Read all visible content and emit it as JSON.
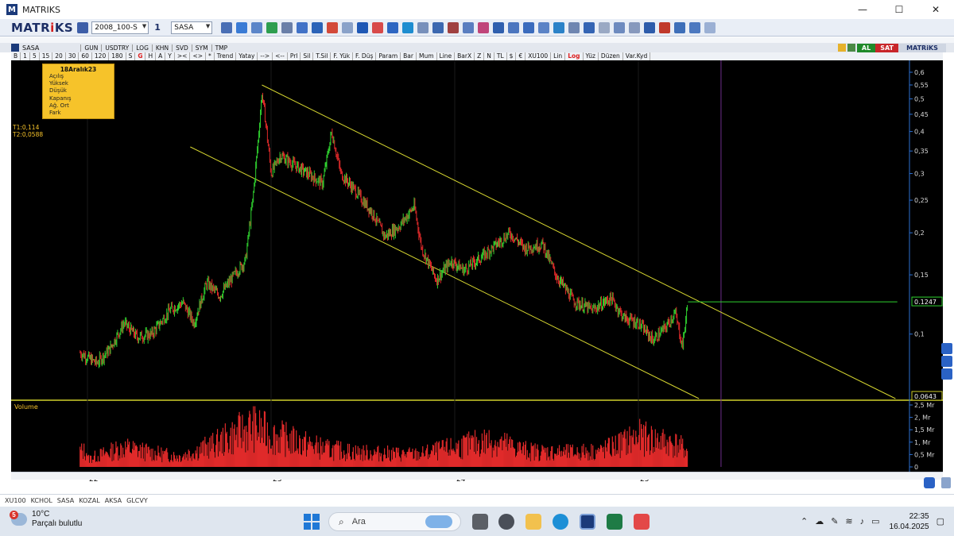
{
  "window": {
    "title": "MATRIKS",
    "min": "—",
    "max": "☐",
    "close": "✕"
  },
  "toolbar": {
    "brand_part1": "MATR",
    "brand_part2": "i",
    "brand_part3": "KS",
    "layout_value": "2008_100-S",
    "count_value": "1",
    "symbol_value": "SASA"
  },
  "toolbar2": {
    "symbol": "SASA",
    "headers": [
      "GUN",
      "USDTRY",
      "LOG",
      "KHN",
      "SVD",
      "SYM",
      "TMP"
    ],
    "buttons": [
      "AL",
      "SAT",
      "MATRiKS"
    ]
  },
  "toolbar3": {
    "items": [
      "B",
      "1",
      "5",
      "15",
      "20",
      "30",
      "60",
      "120",
      "180",
      "S",
      "G",
      "H",
      "A",
      "Y",
      "><",
      "<>",
      "*",
      "Trend",
      "Yatay",
      "-->",
      "<--",
      "Prl",
      "Sil",
      "T.Sil",
      "F. Yük",
      "F. Düş",
      "Param",
      "Bar",
      "Mum",
      "Line",
      "BarX",
      "Z",
      "N",
      "TL",
      "$",
      "€",
      "XU100",
      "Lin",
      "Log",
      "Yüz",
      "Düzen",
      "Var.Kyd"
    ],
    "active": [
      "G",
      "Log"
    ]
  },
  "infobox": {
    "date": "18Aralık23",
    "rows": [
      "Açılış",
      "Yüksek",
      "Düşük",
      "Kapanış",
      "Ağ. Ort",
      "Fark"
    ]
  },
  "tvalues": {
    "t1": "T1:0,114",
    "t2": "T2:0,0588"
  },
  "chart_data": {
    "type": "candlestick",
    "symbol": "SASA",
    "scale": "log",
    "price_axis_ticks": [
      "0,6",
      "0,55",
      "0,5",
      "0,45",
      "0,4",
      "0,35",
      "0,3",
      "0,25",
      "0,2",
      "0,15",
      "0,1"
    ],
    "price_axis_values": [
      0.6,
      0.55,
      0.5,
      0.45,
      0.4,
      0.35,
      0.3,
      0.25,
      0.2,
      0.15,
      0.1
    ],
    "ylim": [
      0.0643,
      0.63
    ],
    "current_price_label": "0.1247",
    "current_price": 0.1247,
    "min_label": "0.0643",
    "x_labels": [
      "22",
      "23",
      "24",
      "25"
    ],
    "x_label_positions_years": [
      2022,
      2023,
      2024,
      2025
    ],
    "price_path": [
      [
        2021.96,
        0.088
      ],
      [
        2022.05,
        0.082
      ],
      [
        2022.12,
        0.09
      ],
      [
        2022.2,
        0.108
      ],
      [
        2022.27,
        0.098
      ],
      [
        2022.35,
        0.1
      ],
      [
        2022.45,
        0.118
      ],
      [
        2022.52,
        0.124
      ],
      [
        2022.58,
        0.108
      ],
      [
        2022.65,
        0.142
      ],
      [
        2022.72,
        0.13
      ],
      [
        2022.8,
        0.15
      ],
      [
        2022.86,
        0.165
      ],
      [
        2022.9,
        0.25
      ],
      [
        2022.93,
        0.38
      ],
      [
        2022.95,
        0.52
      ],
      [
        2022.97,
        0.43
      ],
      [
        2023.0,
        0.3
      ],
      [
        2023.05,
        0.34
      ],
      [
        2023.12,
        0.32
      ],
      [
        2023.2,
        0.3
      ],
      [
        2023.28,
        0.28
      ],
      [
        2023.33,
        0.4
      ],
      [
        2023.38,
        0.3
      ],
      [
        2023.45,
        0.27
      ],
      [
        2023.55,
        0.23
      ],
      [
        2023.62,
        0.195
      ],
      [
        2023.7,
        0.21
      ],
      [
        2023.78,
        0.24
      ],
      [
        2023.82,
        0.18
      ],
      [
        2023.9,
        0.145
      ],
      [
        2023.98,
        0.165
      ],
      [
        2024.05,
        0.155
      ],
      [
        2024.15,
        0.17
      ],
      [
        2024.3,
        0.2
      ],
      [
        2024.38,
        0.18
      ],
      [
        2024.48,
        0.185
      ],
      [
        2024.55,
        0.15
      ],
      [
        2024.65,
        0.125
      ],
      [
        2024.75,
        0.118
      ],
      [
        2024.85,
        0.128
      ],
      [
        2024.92,
        0.112
      ],
      [
        2025.0,
        0.108
      ],
      [
        2025.08,
        0.096
      ],
      [
        2025.15,
        0.105
      ],
      [
        2025.2,
        0.116
      ],
      [
        2025.24,
        0.092
      ],
      [
        2025.27,
        0.1247
      ]
    ],
    "channel_upper": {
      "start": [
        2022.95,
        0.55
      ],
      "end": [
        2026.4,
        0.0643
      ]
    },
    "channel_lower": {
      "start": [
        2022.56,
        0.36
      ],
      "end": [
        2025.33,
        0.0643
      ]
    },
    "horizontal_line": {
      "price": 0.1247,
      "from": 2025.27,
      "to": 2026.41
    },
    "vertical_marker": 2025.45,
    "volume": {
      "label": "Volume",
      "axis_ticks": [
        "2,5 Mr",
        "2, Mr",
        "1,5 Mr",
        "1, Mr",
        "0,5 Mr",
        "0"
      ],
      "axis_values": [
        2.5,
        2.0,
        1.5,
        1.0,
        0.5,
        0
      ],
      "units": "Mr",
      "profile": [
        [
          2022.0,
          0.45
        ],
        [
          2022.2,
          1.1
        ],
        [
          2022.35,
          0.8
        ],
        [
          2022.5,
          0.6
        ],
        [
          2022.7,
          1.3
        ],
        [
          2022.9,
          2.3
        ],
        [
          2023.0,
          1.8
        ],
        [
          2023.3,
          1.0
        ],
        [
          2023.5,
          0.8
        ],
        [
          2023.8,
          0.7
        ],
        [
          2024.0,
          1.1
        ],
        [
          2024.2,
          1.5
        ],
        [
          2024.4,
          0.9
        ],
        [
          2024.6,
          0.8
        ],
        [
          2024.8,
          0.9
        ],
        [
          2025.0,
          1.7
        ],
        [
          2025.2,
          1.3
        ],
        [
          2025.27,
          0.9
        ]
      ]
    }
  },
  "symbol_tabs": [
    "XU100",
    "KCHOL",
    "SASA",
    "KOZAL",
    "AKSA",
    "GLCVY"
  ],
  "taskbar": {
    "temp": "10°C",
    "weather_desc": "Parçalı bulutlu",
    "weather_badge": "5",
    "search_placeholder": "Ara",
    "time": "22:35",
    "date": "16.04.2025"
  }
}
